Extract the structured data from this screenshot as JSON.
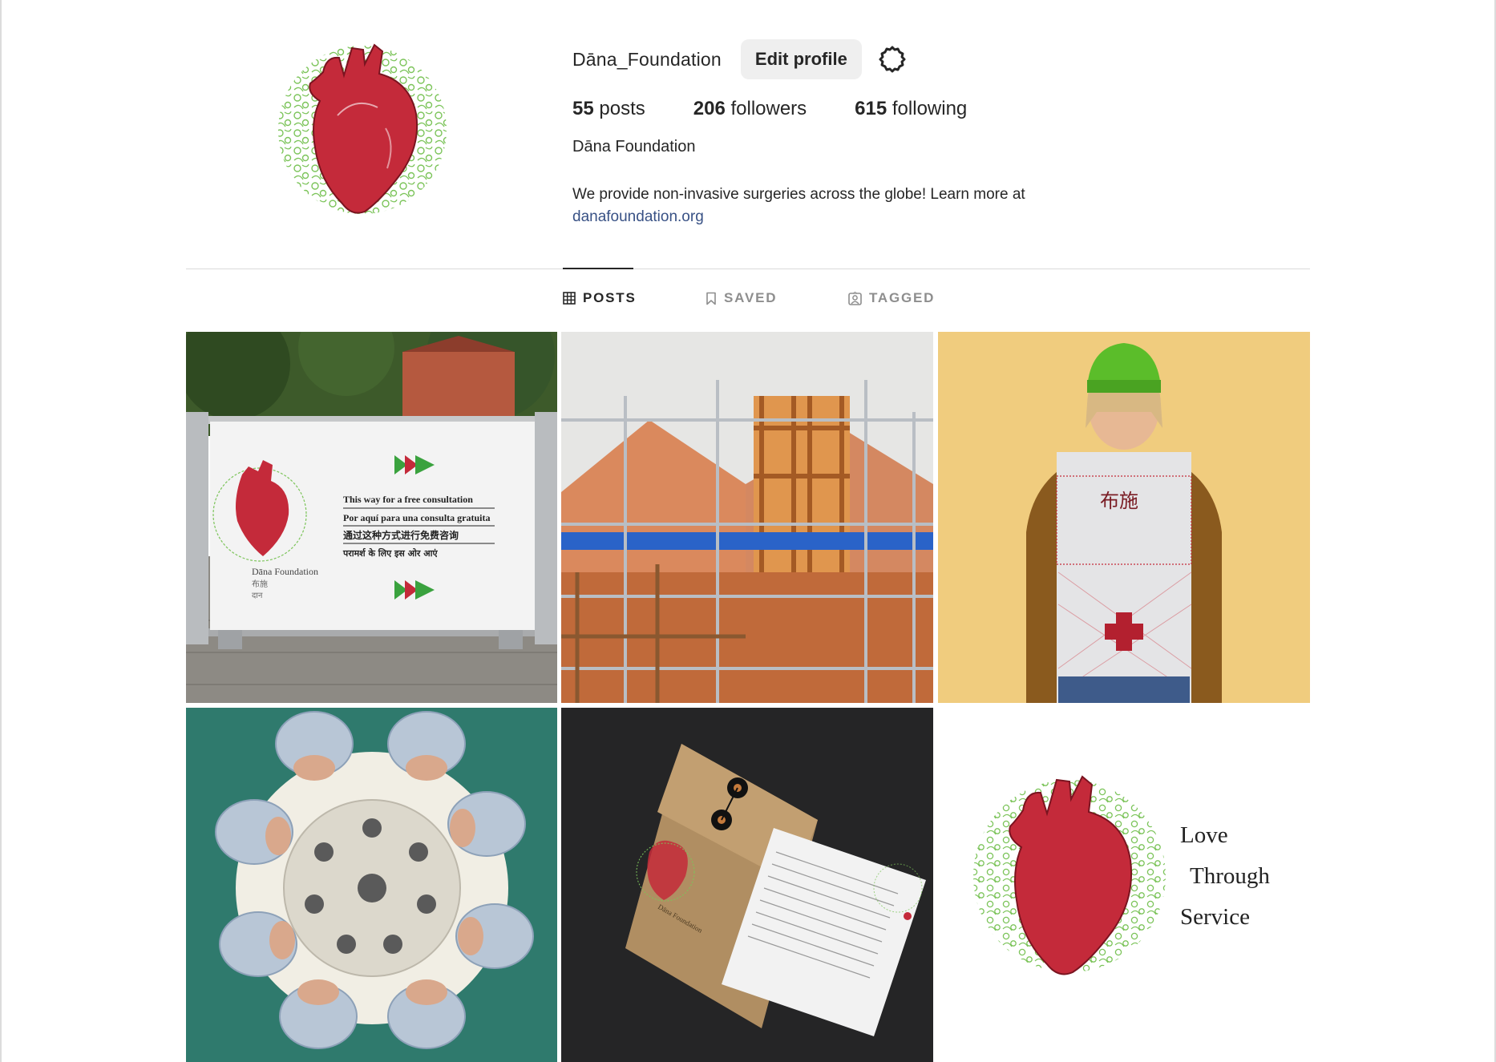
{
  "profile": {
    "username": "Dāna_Foundation",
    "edit_label": "Edit profile",
    "posts_count": "55",
    "posts_label": "posts",
    "followers_count": "206",
    "followers_label": "followers",
    "following_count": "615",
    "following_label": "following",
    "full_name": "Dāna Foundation",
    "bio": "We provide non-invasive surgeries across the globe! Learn more at",
    "link": "danafoundation.org"
  },
  "tabs": [
    {
      "label": "POSTS",
      "icon": "grid-icon",
      "active": true
    },
    {
      "label": "SAVED",
      "icon": "bookmark-icon",
      "active": false
    },
    {
      "label": "TAGGED",
      "icon": "tagged-user-icon",
      "active": false
    }
  ],
  "posts": {
    "banner": {
      "line1": "This way for a free consultation",
      "line2": "Por aquí para una consulta gratuita",
      "line3": "通过这种方式进行免费咨询",
      "line4": "परामर्श के लिए इस ओर आएं",
      "org": "Dāna Foundation",
      "cn": "布施",
      "hi": "दान"
    },
    "hoodie": {
      "text": "布施"
    },
    "envelope": {
      "org": "Dāna Foundation"
    },
    "logo_post": {
      "line1": "Love",
      "line2": "Through",
      "line3": "Service"
    }
  },
  "colors": {
    "brand_red": "#c42a3a",
    "brand_green": "#7cc45a",
    "arrow_green": "#3aa23e",
    "link_blue": "#385185",
    "button_bg": "#efefef"
  }
}
